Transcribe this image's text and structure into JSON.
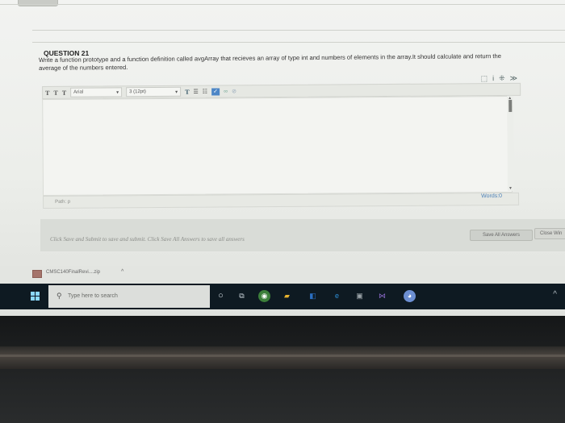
{
  "question": {
    "title": "QUESTION 21",
    "text": "Write a function prototype and a function definition called avgArray that recieves an array of type int and numbers of elements in the array.It should calculate and return the average of the numbers entered."
  },
  "editor": {
    "toolbar": {
      "bold": "T",
      "italic": "T",
      "underline": "T",
      "font_family": "Arial",
      "font_size": "3 (12pt)",
      "text_color_btn": "T",
      "dropdown_caret": "▾"
    },
    "path_label": "Path: p",
    "words_label": "Words:0"
  },
  "submit": {
    "instruction": "Click Save and Submit to save and submit. Click Save All Answers to save all answers",
    "save_all_label": "Save All Answers",
    "save_exit_label": "Close Win"
  },
  "download": {
    "filename": "CMSC140FinalRevi....zip",
    "caret": "^"
  },
  "taskbar": {
    "search_placeholder": "Type here to search",
    "tray_caret": "^"
  },
  "colors": {
    "accent": "#4d86c6",
    "taskbar": "#0e1a22",
    "screen_bg": "#eceeea"
  }
}
